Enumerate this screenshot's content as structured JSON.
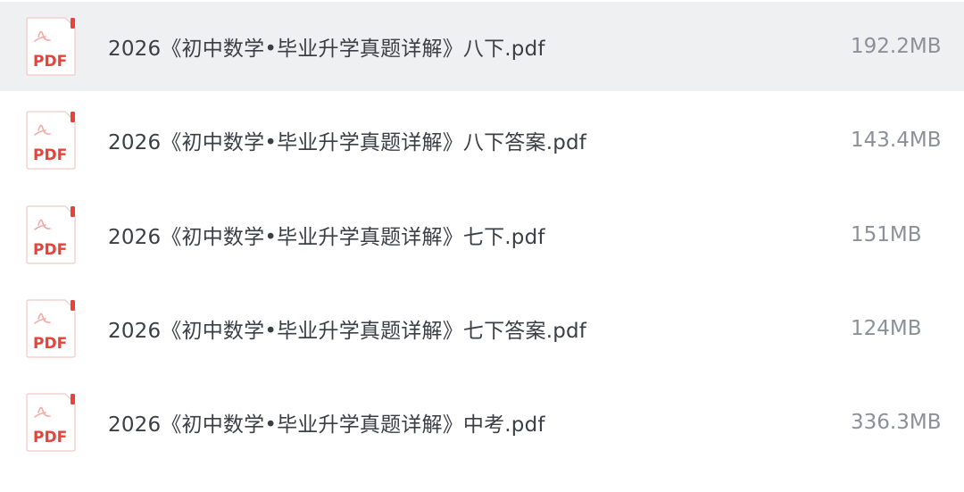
{
  "files": [
    {
      "name": "2026《初中数学•毕业升学真题详解》八下.pdf",
      "size": "192.2MB",
      "icon": "pdf-file-icon",
      "icon_label": "PDF"
    },
    {
      "name": "2026《初中数学•毕业升学真题详解》八下答案.pdf",
      "size": "143.4MB",
      "icon": "pdf-file-icon",
      "icon_label": "PDF"
    },
    {
      "name": "2026《初中数学•毕业升学真题详解》七下.pdf",
      "size": "151MB",
      "icon": "pdf-file-icon",
      "icon_label": "PDF"
    },
    {
      "name": "2026《初中数学•毕业升学真题详解》七下答案.pdf",
      "size": "124MB",
      "icon": "pdf-file-icon",
      "icon_label": "PDF"
    },
    {
      "name": "2026《初中数学•毕业升学真题详解》中考.pdf",
      "size": "336.3MB",
      "icon": "pdf-file-icon",
      "icon_label": "PDF"
    }
  ],
  "colors": {
    "selected_row_bg": "#eff0f2",
    "pdf_red": "#e8423a",
    "name_text": "#3b3e45",
    "size_text": "#8d9099"
  }
}
